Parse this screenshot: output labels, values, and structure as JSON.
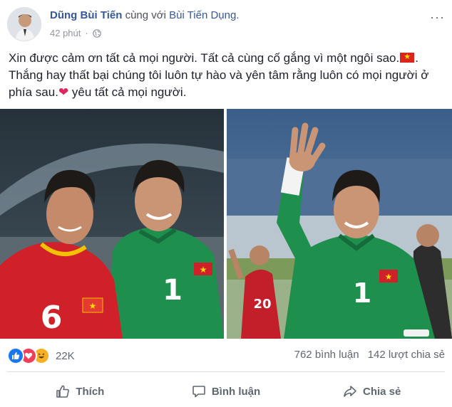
{
  "post": {
    "author": "Dũng Bùi Tiến",
    "with_text": "cùng với",
    "tagged": "Bùi Tiến Dụng.",
    "time": "42 phút",
    "more": "···",
    "text_line1": "Xin được cảm ơn tất cả mọi người. Tất cả cùng cố gắng vì một ngôi sao.",
    "text_line1_end": ".",
    "text_line2": "Thắng hay thất bại chúng tôi luôn tự hào và yên tâm rằng luôn có mọi người ở",
    "text_line3": "phía sau.",
    "text_line3_end": " yêu tất cả mọi người."
  },
  "jerseys": {
    "left_front_number": "6",
    "left_back_number": "1",
    "right_main_number": "1",
    "right_bg_number": "20"
  },
  "stats": {
    "reaction_count": "22K",
    "comments": "762 bình luận",
    "shares": "142 lượt chia sẻ"
  },
  "actions": {
    "like": "Thích",
    "comment": "Bình luận",
    "share": "Chia sẻ"
  },
  "colors": {
    "link": "#365899",
    "meta": "#90949c",
    "jersey_green": "#1f8f4e",
    "jersey_red": "#d0202a"
  }
}
